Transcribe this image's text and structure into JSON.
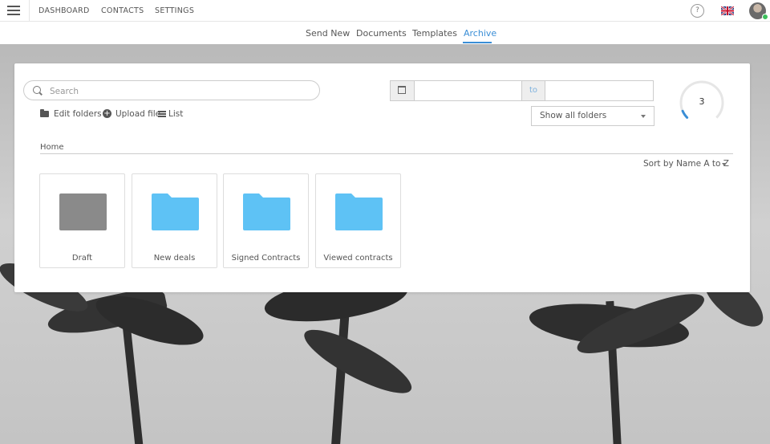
{
  "topnav": {
    "links": [
      "DASHBOARD",
      "CONTACTS",
      "SETTINGS"
    ],
    "help_label": "?"
  },
  "subnav": {
    "tabs": [
      {
        "label": "Send New"
      },
      {
        "label": "Documents"
      },
      {
        "label": "Templates"
      },
      {
        "label": "Archive"
      }
    ],
    "active_color": "#3a8ed6"
  },
  "toolbar": {
    "search_placeholder": "Search",
    "edit_folders": "Edit folders",
    "upload_file": "Upload file",
    "list": "List",
    "date_to": "to",
    "folder_filter": "Show all folders"
  },
  "gauge": {
    "value": "3",
    "fraction": 0.08,
    "color": "#3a8ed6"
  },
  "breadcrumb": "Home",
  "sort_label": "Sort by Name A to Z",
  "folders": [
    {
      "label": "Draft",
      "color": "#8a8a8a"
    },
    {
      "label": "New deals",
      "color": "#5ec2f5"
    },
    {
      "label": "Signed Contracts",
      "color": "#5ec2f5"
    },
    {
      "label": "Viewed contracts",
      "color": "#5ec2f5"
    }
  ]
}
